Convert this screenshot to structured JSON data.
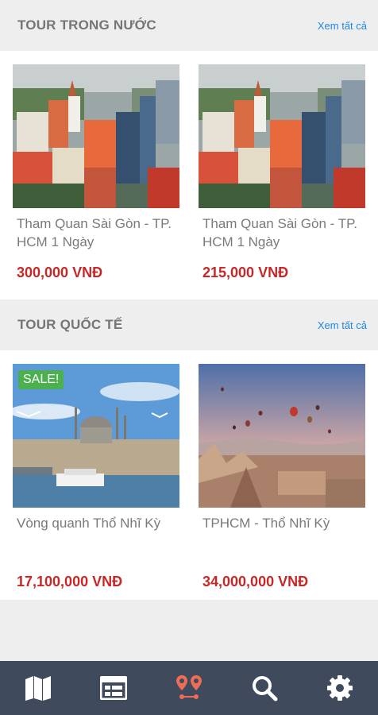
{
  "sections": [
    {
      "title": "TOUR TRONG NƯỚC",
      "see_all": "Xem tất cả",
      "tours": [
        {
          "title": "Tham Quan Sài Gòn - TP. HCM 1 Ngày",
          "price": "300,000 VNĐ",
          "image": "saigon-city-aerial"
        },
        {
          "title": "Tham Quan Sài Gòn - TP. HCM 1 Ngày",
          "price": "215,000 VNĐ",
          "image": "saigon-city-aerial"
        }
      ]
    },
    {
      "title": "TOUR QUỐC TẾ",
      "see_all": "Xem tất cả",
      "tours": [
        {
          "title": "Vòng quanh Thổ Nhĩ Kỳ",
          "price": "17,100,000 VNĐ",
          "badge": "SALE!",
          "image": "istanbul-mosque"
        },
        {
          "title": "TPHCM - Thổ Nhĩ Kỳ",
          "price": "34,000,000 VNĐ",
          "image": "cappadocia-balloons"
        }
      ]
    }
  ],
  "bottom_nav": {
    "items": [
      {
        "icon": "map-icon"
      },
      {
        "icon": "calendar-icon"
      },
      {
        "icon": "route-pin-icon",
        "active": true
      },
      {
        "icon": "search-icon"
      },
      {
        "icon": "gear-icon"
      }
    ],
    "active_color": "#ef6c57",
    "icon_color": "#ffffff"
  },
  "colors": {
    "price": "#c62828",
    "link": "#1e88e5",
    "sale_badge": "#4caf50",
    "nav_bg": "#3f4a5c"
  }
}
